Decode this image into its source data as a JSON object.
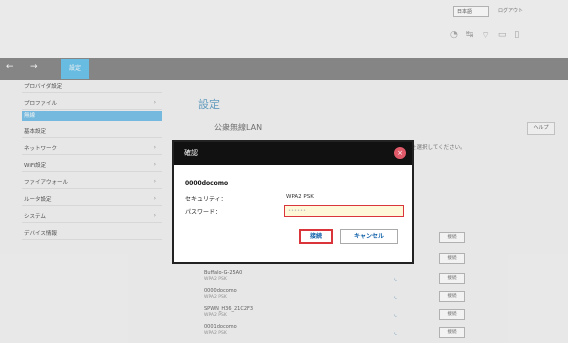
{
  "header": {
    "language_select": "日本語",
    "logout_link": "ログアウト"
  },
  "nav": {
    "back": "←",
    "forward": "→",
    "active_tab": "設定"
  },
  "sidebar": {
    "items": [
      {
        "label": "プロバイダ設定"
      },
      {
        "label": "プロファイル"
      },
      {
        "label": "無線"
      },
      {
        "label": "基本設定"
      },
      {
        "label": "ネットワーク"
      },
      {
        "label": "WiFi設定"
      },
      {
        "label": "ファイアウォール"
      },
      {
        "label": "ルータ設定"
      },
      {
        "label": "システム"
      },
      {
        "label": "デバイス情報"
      }
    ]
  },
  "main": {
    "page_title": "設定",
    "section_title": "公衆無線LAN",
    "help_button": "ヘルプ",
    "description": "を選択してください。",
    "networks": [
      {
        "name": "0000docomo",
        "security": "WPA2 PSK"
      },
      {
        "name": "Buffalo-G-25A0",
        "security": "WPA2 PSK"
      },
      {
        "name": "0000docomo",
        "security": "WPA2 PSK"
      },
      {
        "name": "SPWN_H36_21C2F3",
        "security": "WPA2 PSK"
      },
      {
        "name": "0001docomo",
        "security": "WPA2 PSK"
      }
    ],
    "connect_label": "接続"
  },
  "dialog": {
    "title": "確認",
    "close": "×",
    "ssid": "0000docomo",
    "security_label": "セキュリティ：",
    "security_value": "WPA2 PSK",
    "password_label": "パスワード：",
    "password_value": "••••••",
    "ok_button": "接続",
    "cancel_button": "キャンセル"
  },
  "colors": {
    "accent": "#6ec6ee",
    "navbar": "#8d8d8d",
    "highlight_red": "#d9353a",
    "link_blue": "#0b5da8"
  }
}
